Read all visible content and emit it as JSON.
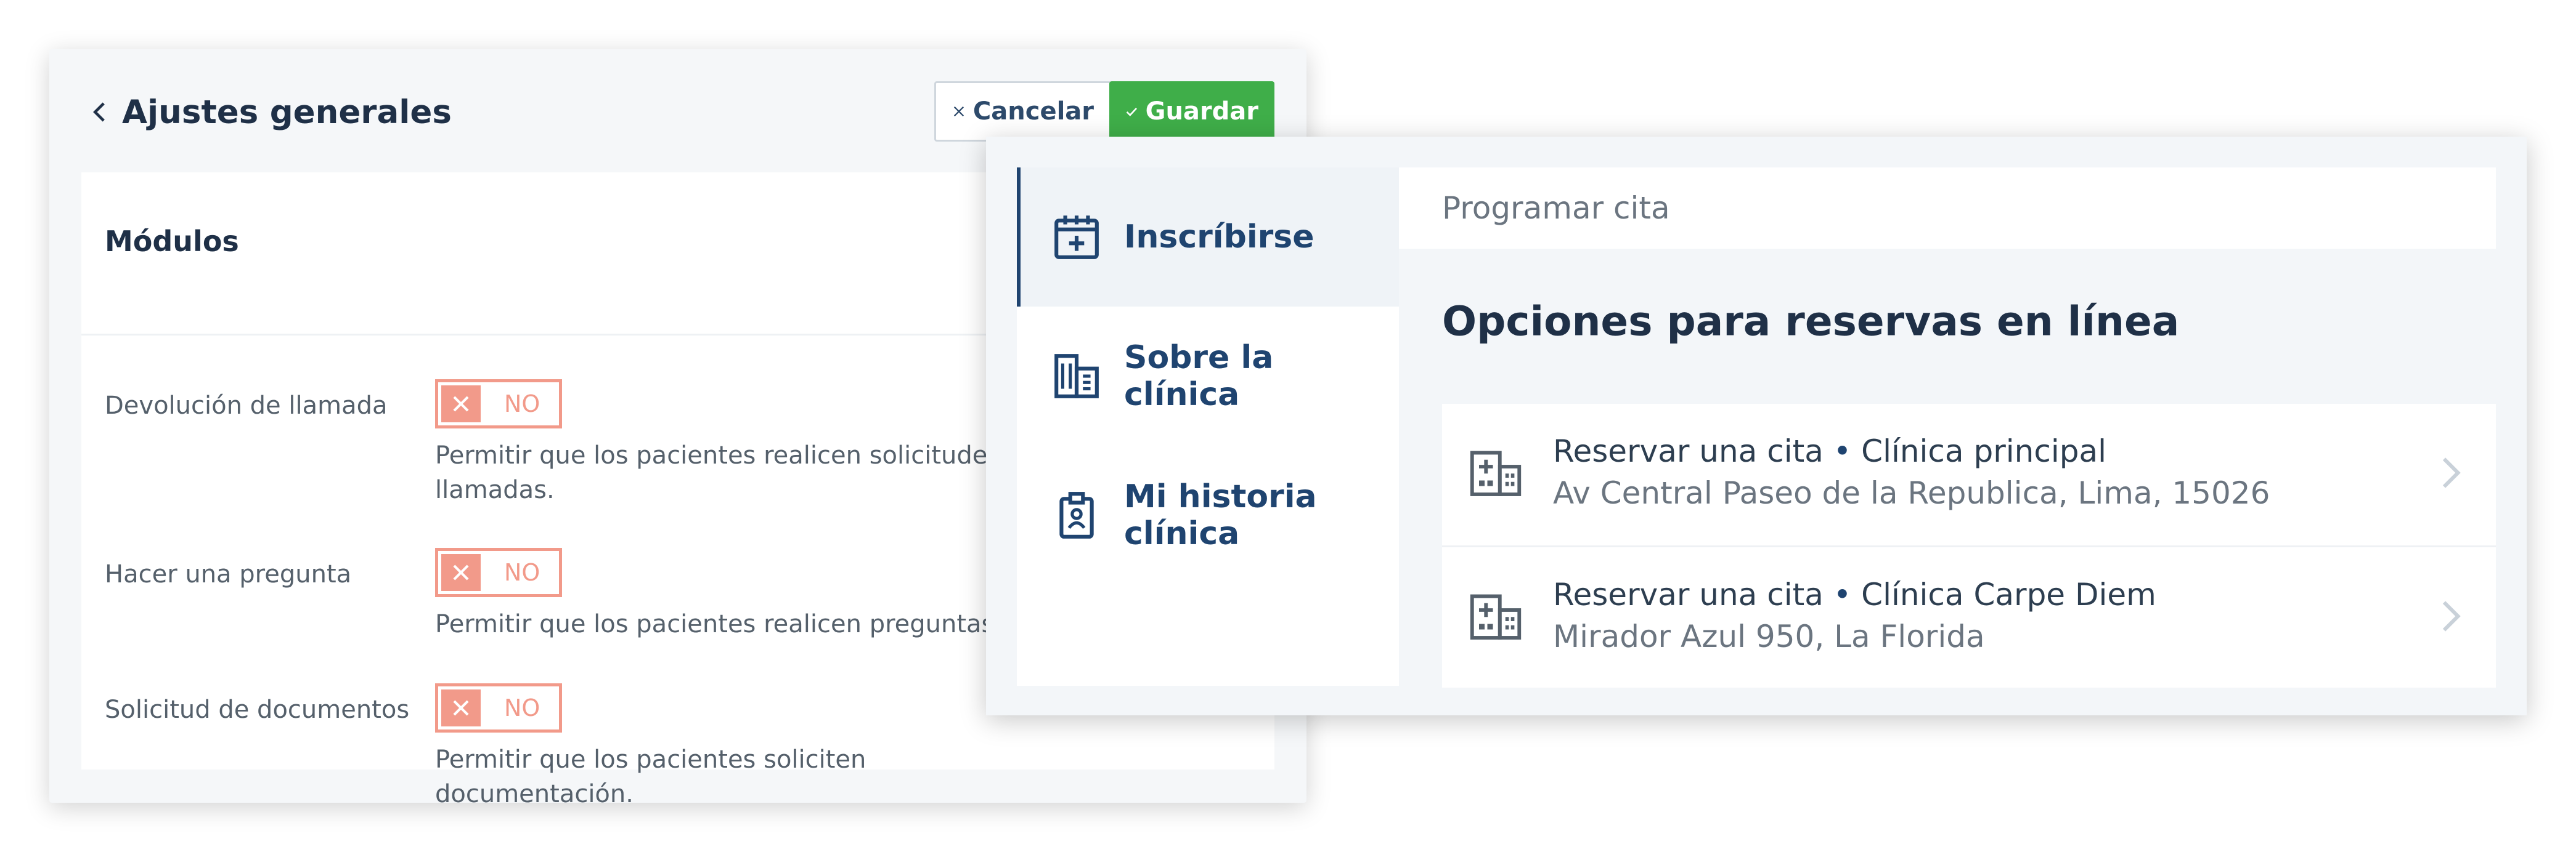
{
  "settings": {
    "back_label": "Ajustes generales",
    "cancel_label": "Cancelar",
    "save_label": "Guardar",
    "section_title": "Módulos",
    "toggle_off_text": "NO",
    "rows": [
      {
        "label": "Devolución de llamada",
        "state": "NO",
        "description": "Permitir que los pacientes realicen solicitudes de llamadas."
      },
      {
        "label": "Hacer una pregunta",
        "state": "NO",
        "description": "Permitir que los pacientes realicen preguntas."
      },
      {
        "label": "Solicitud de documentos",
        "state": "NO",
        "description": "Permitir que los pacientes soliciten documentación."
      }
    ],
    "colors": {
      "save": "#3fae49",
      "toggle_off": "#f29a8a",
      "title": "#1f3047"
    }
  },
  "booking": {
    "nav": [
      {
        "label": "Inscríbirse",
        "icon": "calendar-plus-icon",
        "active": true
      },
      {
        "label": "Sobre la clínica",
        "icon": "building-icon",
        "active": false
      },
      {
        "label": "Mi historia clínica",
        "icon": "clipboard-user-icon",
        "active": false
      }
    ],
    "tab_label": "Programar cita",
    "content_title": "Opciones para reservas en línea",
    "locations": [
      {
        "action": "Reservar una cita",
        "separator": "•",
        "name": "Clínica principal",
        "address": "Av Central Paseo de la Republica, Lima, 15026"
      },
      {
        "action": "Reservar una cita",
        "separator": "•",
        "name": "Clínica Carpe Diem",
        "address": "Mirador Azul 950, La Florida"
      }
    ],
    "colors": {
      "accent": "#1f4470",
      "muted": "#6b7580"
    }
  }
}
